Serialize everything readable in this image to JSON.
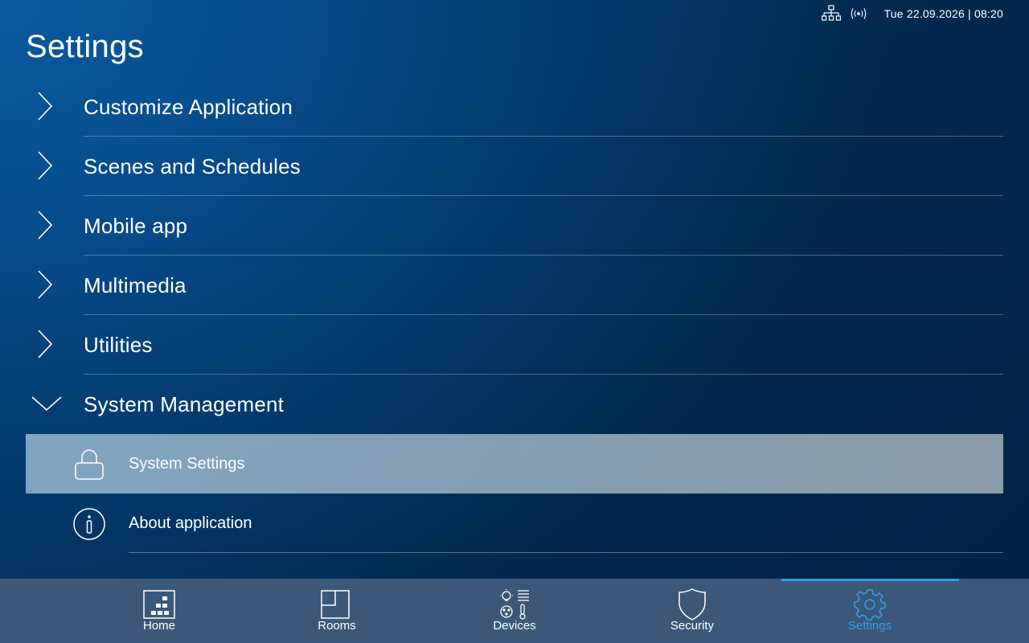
{
  "status": {
    "datetime": "Tue 22.09.2026 | 08:20",
    "icons": [
      "network-icon",
      "wireless-signal-icon"
    ]
  },
  "page": {
    "title": "Settings"
  },
  "menu": [
    {
      "label": "Customize Application",
      "state": "collapsed"
    },
    {
      "label": "Scenes and Schedules",
      "state": "collapsed"
    },
    {
      "label": "Mobile app",
      "state": "collapsed"
    },
    {
      "label": "Multimedia",
      "state": "collapsed"
    },
    {
      "label": "Utilities",
      "state": "collapsed"
    },
    {
      "label": "System Management",
      "state": "expanded"
    }
  ],
  "submenu": [
    {
      "label": "System Settings",
      "icon": "lock-icon",
      "selected": true
    },
    {
      "label": "About application",
      "icon": "info-icon",
      "selected": false
    }
  ],
  "nav": [
    {
      "label": "Home",
      "icon": "home-icon",
      "active": false
    },
    {
      "label": "Rooms",
      "icon": "rooms-icon",
      "active": false
    },
    {
      "label": "Devices",
      "icon": "devices-icon",
      "active": false
    },
    {
      "label": "Security",
      "icon": "shield-icon",
      "active": false
    },
    {
      "label": "Settings",
      "icon": "gear-icon",
      "active": true
    }
  ],
  "colors": {
    "accent": "#2f9ce8",
    "nav_bg": "#3b5879",
    "bg_top": "#0a5aa0",
    "bg_bottom": "#032b52",
    "selected_row": "#a9c2d4"
  }
}
